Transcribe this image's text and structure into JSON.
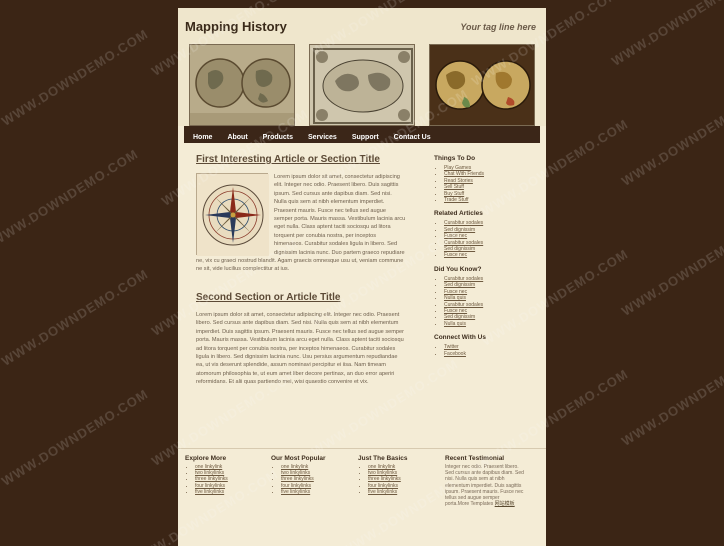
{
  "header": {
    "title": "Mapping History",
    "tagline": "Your tag line here"
  },
  "banners": [
    {
      "name": "banner-map-world-two-hemispheres"
    },
    {
      "name": "banner-map-old-engraved-world"
    },
    {
      "name": "banner-map-colored-world"
    }
  ],
  "nav": {
    "items": [
      "Home",
      "About",
      "Products",
      "Services",
      "Support",
      "Contact Us"
    ]
  },
  "main": {
    "article1": {
      "title": "First Interesting Article or Section Title",
      "body": "Lorem ipsum dolor sit amet, consectetur adipiscing elit. Integer nec odio. Praesent libero. Duis sagittis ipsum. Sed cursus ante dapibus diam. Sed nisi. Nulla quis sem at nibh elementum imperdiet. Praesent mauris. Fusce nec tellus sed augue semper porta. Mauris massa. Vestibulum lacinia arcu eget nulla. Class aptent taciti sociosqu ad litora torquent per conubia nostra, per inceptos himenaeos. Curabitur sodales ligula in libero. Sed dignissim lacinia nunc. Duo partem graeco repudiare ne, vix cu graeci nostrud blandit. Agam graecis omnesque usu ut, veniam commune ne sit, vide lucilius complectitur at ius."
    },
    "article2": {
      "title": "Second Section or Article Title",
      "body": "Lorem ipsum dolor sit amet, consectetur adipiscing elit. Integer nec odio. Praesent libero. Sed cursus ante dapibus diam. Sed nisi. Nulla quis sem at nibh elementum imperdiet. Duis sagittis ipsum. Praesent mauris. Fusce nec tellus sed augue semper porta. Mauris massa. Vestibulum lacinia arcu eget nulla. Class aptent taciti sociosqu ad litora torquent per conubia nostra, per inceptos himenaeos. Curabitur sodales ligula in libero. Sed dignissim lacinia nunc. Usu persius argumentum repudiandae ea, ut vis deserunt splendide, assum nominavi percipitur ei iisa. Nam timeam atomorum philosophia te, ut eum amet liber decore pertinax, an duo error aperiri reformidans. Et alii quas partiendo mei, wisi quaestio convenire et vix."
    }
  },
  "sidebar": {
    "sections": [
      {
        "heading": "Things To Do",
        "items": [
          "Play Games",
          "Chat With Friends",
          "Read Stories",
          "Sell Stuff",
          "Buy Stuff",
          "Trade Stuff"
        ]
      },
      {
        "heading": "Related Articles",
        "items": [
          "Curabitur sodales",
          "Sed dignissim",
          "Fusce nec",
          "Curabitur sodales",
          "Sed dignissim",
          "Fusce nec"
        ]
      },
      {
        "heading": "Did You Know?",
        "items": [
          "Curabitur sodales",
          "Sed dignissim",
          "Fusce nec",
          "Nulla quis",
          "Curabitur sodales",
          "Fusce nec",
          "Sed dignissim",
          "Nulla quis"
        ]
      },
      {
        "heading": "Connect With Us",
        "items": [
          "Twitter",
          "Facebook"
        ]
      }
    ]
  },
  "footer": {
    "cols": [
      {
        "heading": "Explore More",
        "items": [
          "one linkylink",
          "two linkylinks",
          "three linkylinks",
          "four linkylinks",
          "five linkylinks"
        ]
      },
      {
        "heading": "Our Most Popular",
        "items": [
          "one linkylink",
          "two linkylinks",
          "three linkylinks",
          "four linkylinks",
          "five linkylinks"
        ]
      },
      {
        "heading": "Just The Basics",
        "items": [
          "one linkylink",
          "two linkylinks",
          "three linkylinks",
          "four linkylinks",
          "five linkylinks"
        ]
      }
    ],
    "testimonial": {
      "heading": "Recent Testimonial",
      "text": "Integer nec odio. Praesent libero. Sed cursus ante dapibus diam. Sed nisi. Nulla quis sem at nibh elementum imperdiet. Duis sagittis ipsum. Praesent mauris. Fusce nec tellus sed augue semper porta.More Templates",
      "name": "网站模板"
    }
  },
  "watermark": "WWW.DOWNDEMO.COM"
}
